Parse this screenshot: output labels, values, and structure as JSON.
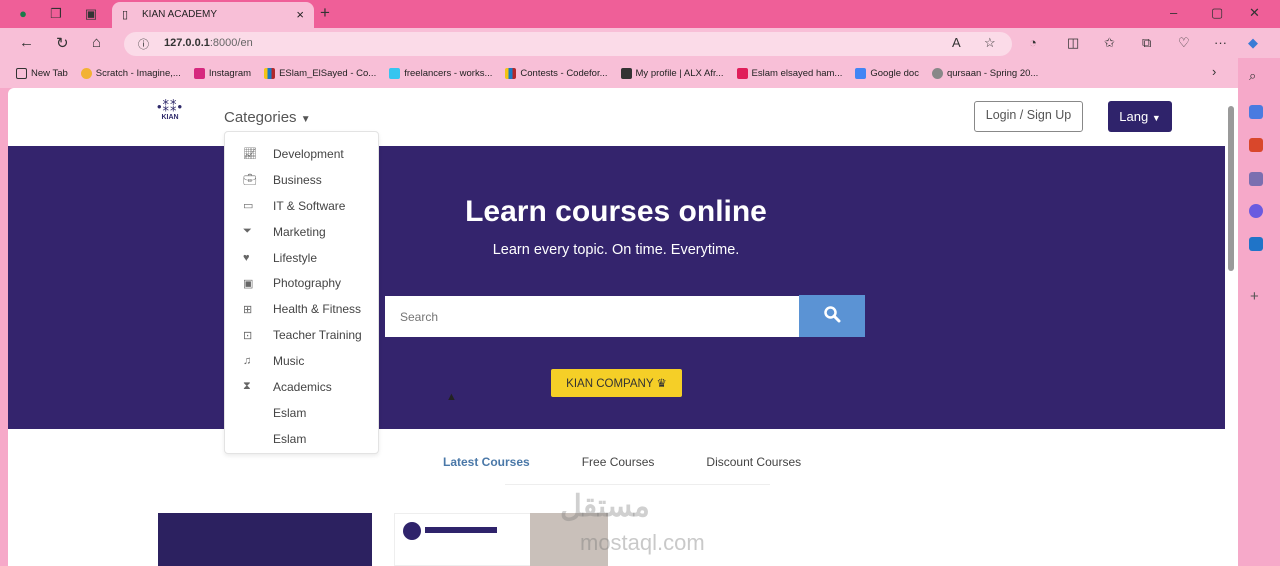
{
  "browser": {
    "tab_title": "KIAN ACADEMY",
    "url_host": "127.0.0.1",
    "url_rest": ":8000/en",
    "bookmarks": [
      "New Tab",
      "Scratch - Imagine,...",
      "Instagram",
      "ESlam_ElSayed - Co...",
      "freelancers - works...",
      "Contests - Codefor...",
      "My profile | ALX Afr...",
      "Eslam elsayed ham...",
      "Google doc",
      "qursaan - Spring 20..."
    ]
  },
  "nav": {
    "logo_text": "KIAN",
    "categories_label": "Categories",
    "login_label": "Login / Sign Up",
    "lang_label": "Lang"
  },
  "categories": [
    {
      "icon": "chart-line-icon",
      "label": "Development"
    },
    {
      "icon": "briefcase-icon",
      "label": "Business"
    },
    {
      "icon": "laptop-icon",
      "label": "IT & Software"
    },
    {
      "icon": "funnel-icon",
      "label": "Marketing"
    },
    {
      "icon": "heart-pulse-icon",
      "label": "Lifestyle"
    },
    {
      "icon": "image-icon",
      "label": "Photography"
    },
    {
      "icon": "medkit-icon",
      "label": "Health & Fitness"
    },
    {
      "icon": "chalkboard-teacher-icon",
      "label": "Teacher Training"
    },
    {
      "icon": "music-icon",
      "label": "Music"
    },
    {
      "icon": "graduate-icon",
      "label": "Academics"
    },
    {
      "icon": "",
      "label": "Eslam"
    },
    {
      "icon": "",
      "label": "Eslam"
    }
  ],
  "hero": {
    "title": "Learn courses online",
    "subtitle": "Learn every topic. On time. Everytime.",
    "search_placeholder": "Search",
    "company_button": "KIAN COMPANY",
    "colors": {
      "hero_bg": "#34246d",
      "search_btn": "#5b93d4",
      "company_btn": "#f5cf27"
    }
  },
  "course_tabs": [
    "Latest Courses",
    "Free Courses",
    "Discount Courses"
  ],
  "watermark": {
    "arabic": "مستقل",
    "latin": "mostaql.com"
  }
}
